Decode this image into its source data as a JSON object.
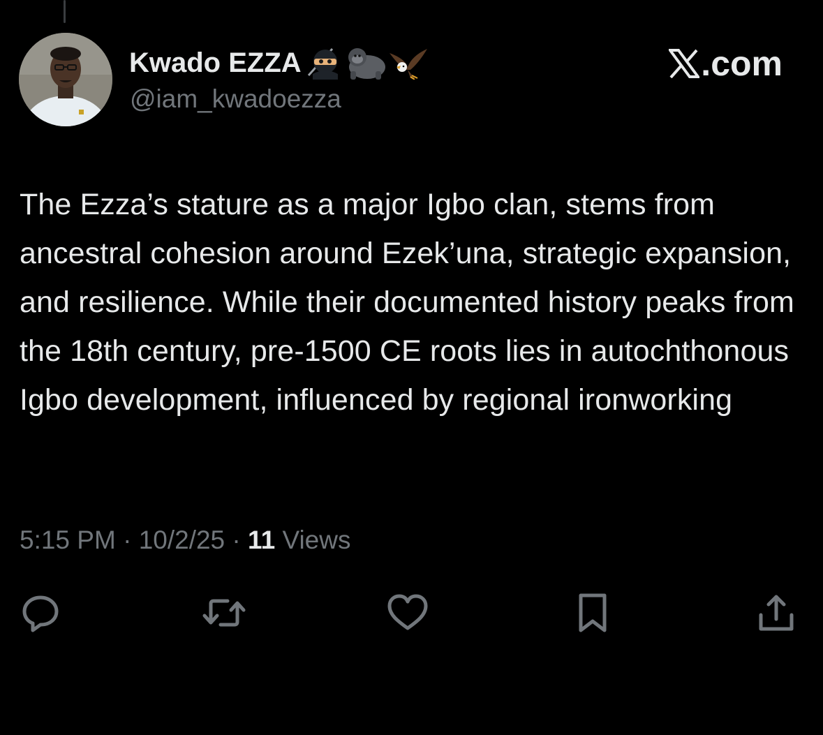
{
  "author": {
    "display_name": "Kwado EZZA",
    "name_emojis": [
      "ninja-emoji",
      "gorilla-emoji",
      "eagle-emoji"
    ],
    "handle": "@iam_kwadoezza",
    "avatar": "profile-photo"
  },
  "watermark": {
    "text": ".com",
    "logo": "x-logo-icon"
  },
  "tweet": {
    "text": "The Ezza’s stature as a major Igbo clan, stems from ancestral cohesion around Ezek’una, strategic expansion, and resilience. While their documented history peaks from the 18th century, pre-1500 CE roots lies in autochthonous Igbo development, influenced by regional ironworking"
  },
  "meta": {
    "time": "5:15 PM",
    "separator": " · ",
    "date": "10/2/25",
    "views_count": "11",
    "views_label": "Views"
  },
  "actions": [
    {
      "name": "reply",
      "icon": "reply-icon"
    },
    {
      "name": "repost",
      "icon": "repost-icon"
    },
    {
      "name": "like",
      "icon": "heart-icon"
    },
    {
      "name": "bookmark",
      "icon": "bookmark-icon"
    },
    {
      "name": "share",
      "icon": "share-icon"
    }
  ],
  "colors": {
    "background": "#000000",
    "primary_text": "#e7e9ea",
    "secondary_text": "#71767b",
    "icon": "#71767b"
  }
}
